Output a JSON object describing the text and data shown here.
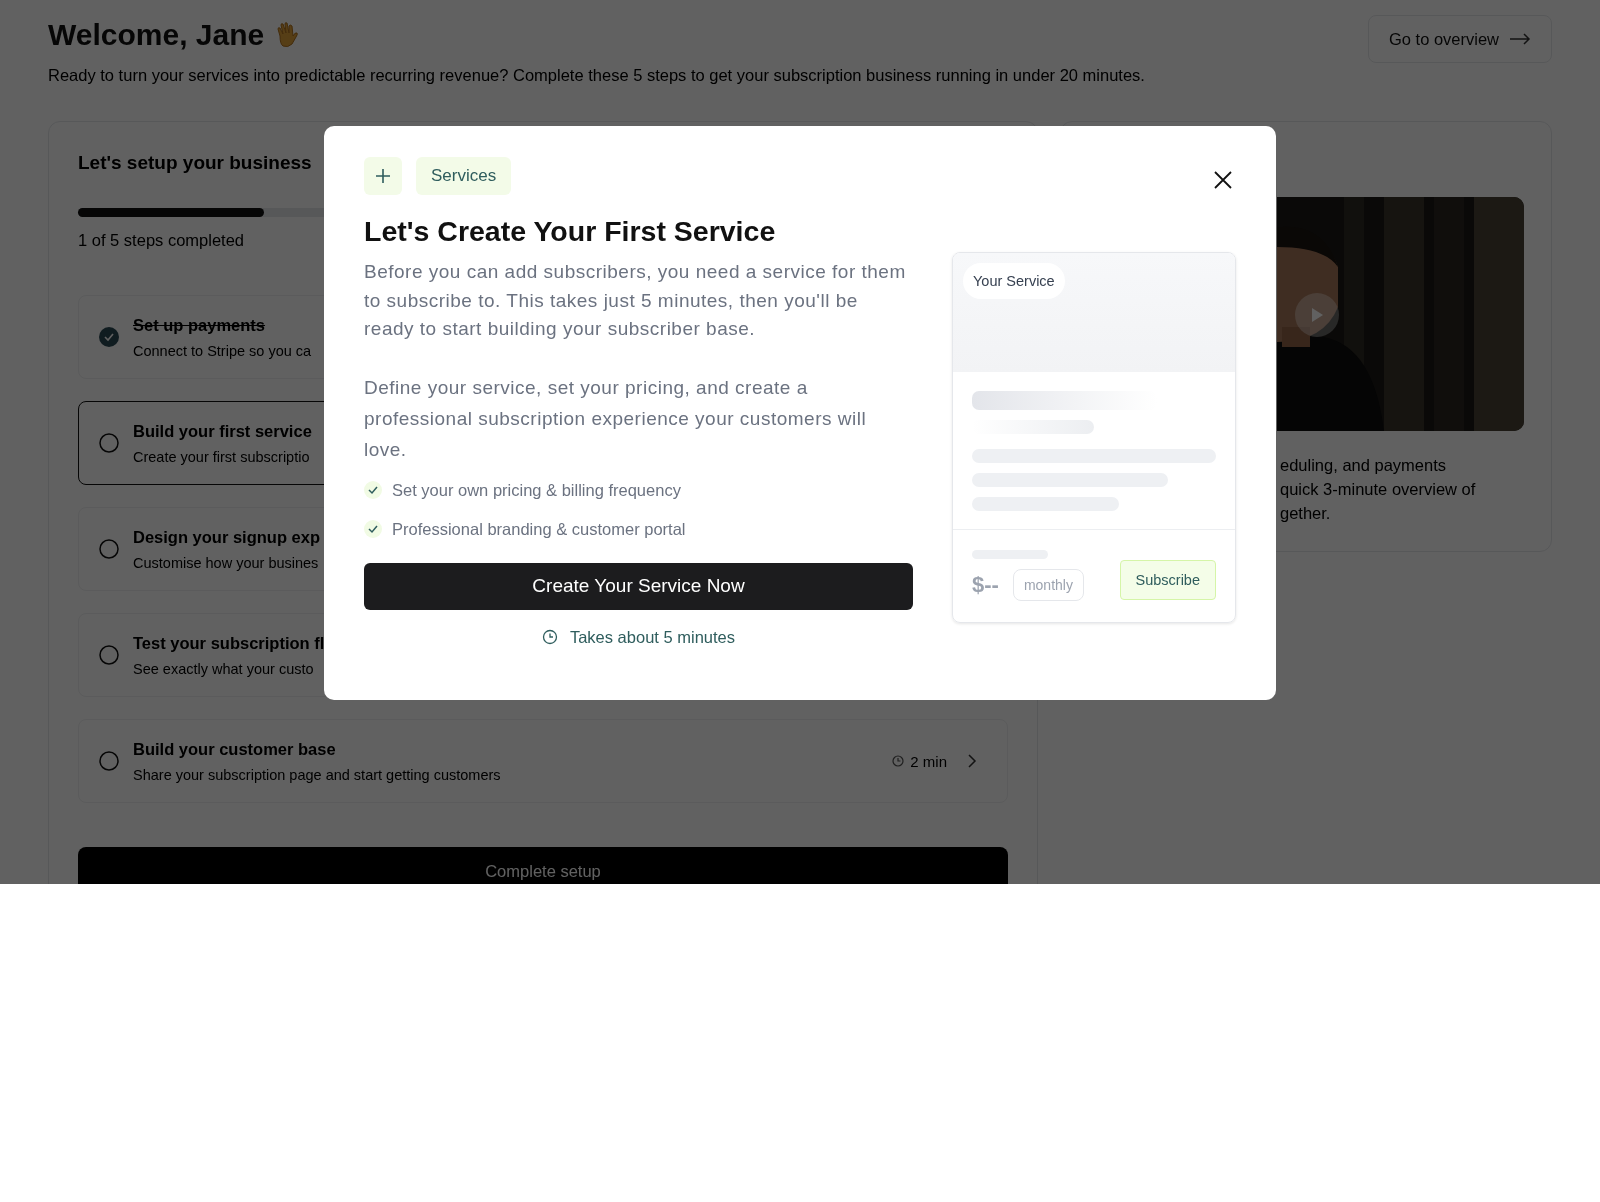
{
  "header": {
    "title": "Welcome, Jane",
    "subtitle": "Ready to turn your services into predictable recurring revenue? Complete these 5 steps to get your subscription business running in under 20 minutes.",
    "overview_button": "Go to overview"
  },
  "setup": {
    "title": "Let's setup your business",
    "level": 0.2,
    "progress_text": "1 of 5 steps completed",
    "steps": [
      {
        "title": "Set up payments",
        "description": "Connect to Stripe so you ca",
        "done": true,
        "selected": false
      },
      {
        "title": "Build your first service",
        "description": "Create your first subscriptio",
        "done": false,
        "selected": true
      },
      {
        "title": "Design your signup exp",
        "description": "Customise how your busines",
        "done": false,
        "selected": false
      },
      {
        "title": "Test your subscription fl",
        "description": "See exactly what your custo",
        "done": false,
        "selected": false
      },
      {
        "title": "Build your customer base",
        "description": "Share your subscription page and start getting customers",
        "done": false,
        "selected": false,
        "time": "2 min"
      }
    ],
    "complete_button": "Complete setup"
  },
  "video_panel": {
    "lines": [
      "eduling, and payments",
      "quick 3-minute overview of",
      "gether."
    ]
  },
  "modal": {
    "badge": "Services",
    "title": "Let's Create Your First Service",
    "paragraphs": [
      "Before you can add subscribers, you need a service for them to subscribe to. This takes just 5 minutes, then you'll be ready to start building your subscriber base.",
      "Define your service, set your pricing, and create a professional subscription experience your customers will love."
    ],
    "features": [
      "Set your own pricing & billing frequency",
      "Professional branding & customer portal"
    ],
    "button": "Create Your Service Now",
    "duration": "Takes about 5 minutes",
    "preview": {
      "name": "Your Service",
      "price": "$--",
      "period": "monthly",
      "button": "Subscribe"
    }
  }
}
